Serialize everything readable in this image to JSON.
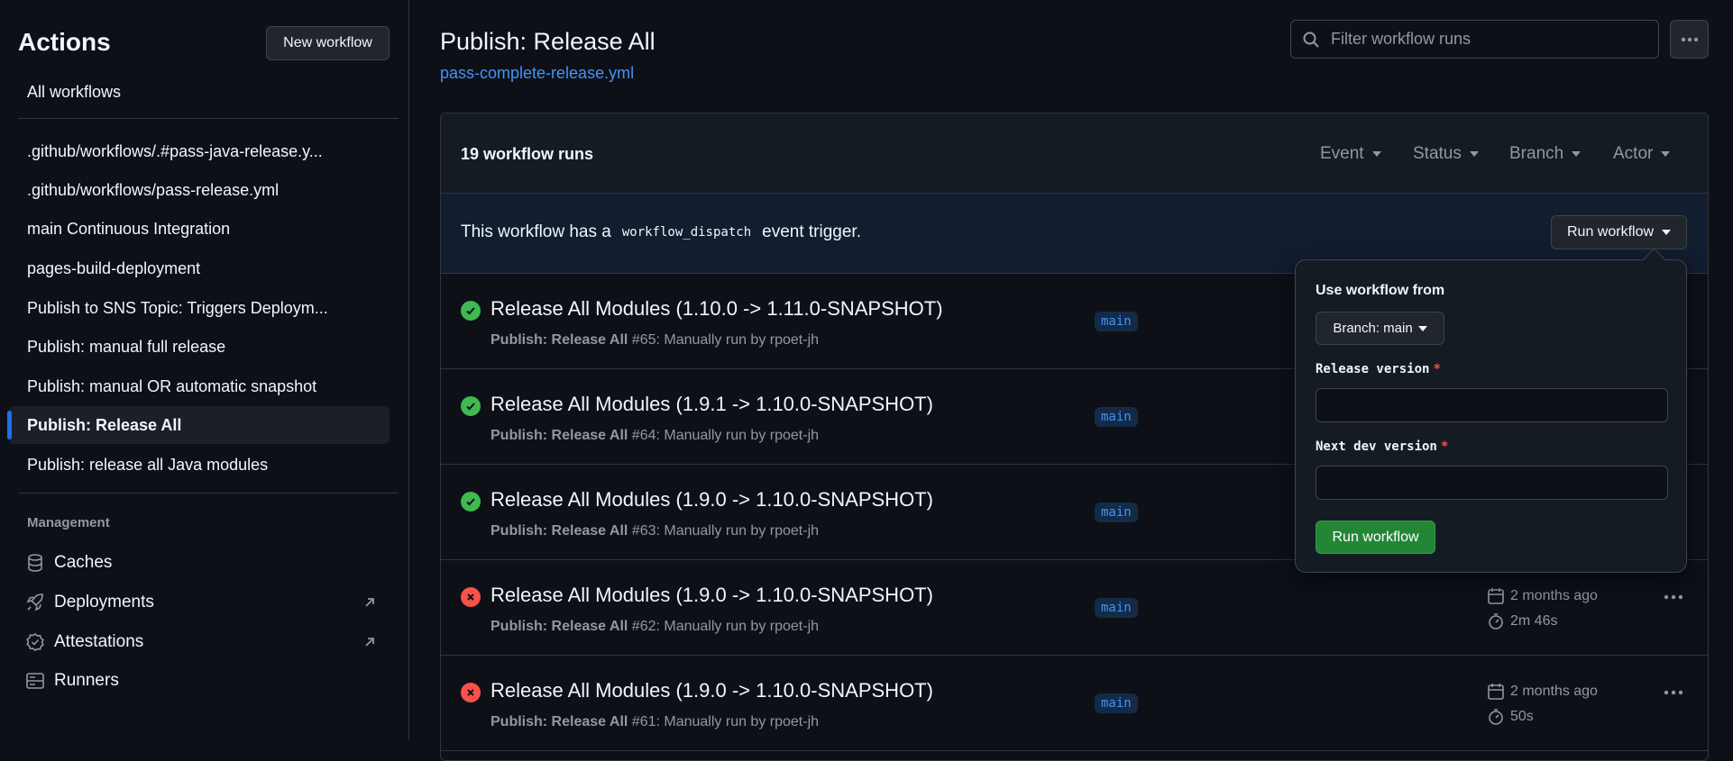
{
  "sidebar": {
    "title": "Actions",
    "new_workflow_label": "New workflow",
    "all_workflows_label": "All workflows",
    "workflows": [
      {
        "label": ".github/workflows/.#pass-java-release.y..."
      },
      {
        "label": ".github/workflows/pass-release.yml"
      },
      {
        "label": "main Continuous Integration"
      },
      {
        "label": "pages-build-deployment"
      },
      {
        "label": "Publish to SNS Topic: Triggers Deploym..."
      },
      {
        "label": "Publish: manual full release"
      },
      {
        "label": "Publish: manual OR automatic snapshot"
      },
      {
        "label": "Publish: Release All",
        "active": true
      },
      {
        "label": "Publish: release all Java modules"
      }
    ],
    "management_label": "Management",
    "management_items": [
      {
        "label": "Caches",
        "icon": "database-icon"
      },
      {
        "label": "Deployments",
        "icon": "rocket-icon",
        "external": true
      },
      {
        "label": "Attestations",
        "icon": "verified-icon",
        "external": true
      },
      {
        "label": "Runners",
        "icon": "server-icon"
      }
    ]
  },
  "header": {
    "title": "Publish: Release All",
    "file_link": "pass-complete-release.yml",
    "filter_placeholder": "Filter workflow runs"
  },
  "runs": {
    "count_label": "19 workflow runs",
    "filters": [
      "Event",
      "Status",
      "Branch",
      "Actor"
    ],
    "dispatch_prefix": "This workflow has a",
    "dispatch_code": "workflow_dispatch",
    "dispatch_suffix": "event trigger.",
    "run_workflow_label": "Run workflow",
    "items": [
      {
        "title": "Release All Modules (1.10.0 -> 1.11.0-SNAPSHOT)",
        "workflow": "Publish: Release All",
        "detail": "#65: Manually run by rpoet-jh",
        "branch": "main",
        "status": "success",
        "date": "",
        "duration": ""
      },
      {
        "title": "Release All Modules (1.9.1 -> 1.10.0-SNAPSHOT)",
        "workflow": "Publish: Release All",
        "detail": "#64: Manually run by rpoet-jh",
        "branch": "main",
        "status": "success",
        "date": "",
        "duration": ""
      },
      {
        "title": "Release All Modules (1.9.0 -> 1.10.0-SNAPSHOT)",
        "workflow": "Publish: Release All",
        "detail": "#63: Manually run by rpoet-jh",
        "branch": "main",
        "status": "success",
        "date": "",
        "duration": ""
      },
      {
        "title": "Release All Modules (1.9.0 -> 1.10.0-SNAPSHOT)",
        "workflow": "Publish: Release All",
        "detail": "#62: Manually run by rpoet-jh",
        "branch": "main",
        "status": "failure",
        "date": "2 months ago",
        "duration": "2m 46s"
      },
      {
        "title": "Release All Modules (1.9.0 -> 1.10.0-SNAPSHOT)",
        "workflow": "Publish: Release All",
        "detail": "#61: Manually run by rpoet-jh",
        "branch": "main",
        "status": "failure",
        "date": "2 months ago",
        "duration": "50s"
      }
    ]
  },
  "dropdown": {
    "use_from_label": "Use workflow from",
    "branch_label": "Branch: main",
    "release_version_label": "Release version",
    "next_dev_version_label": "Next dev version",
    "required_mark": "*",
    "release_version_value": "",
    "next_dev_version_value": "",
    "submit_label": "Run workflow"
  },
  "colors": {
    "background": "#0d1117",
    "accent_blue": "#4493f8",
    "success_green": "#3fb950",
    "failure_red": "#f85149",
    "run_button_green": "#238636"
  }
}
